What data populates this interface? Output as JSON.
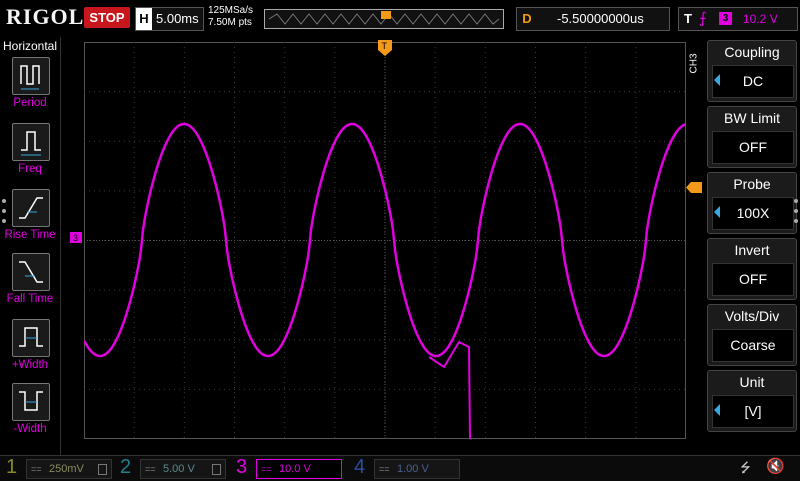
{
  "brand": "RIGOL",
  "status": "STOP",
  "horizontal": {
    "label": "H",
    "timebase": "5.00ms"
  },
  "sample_rate": "125MSa/s",
  "memory_depth": "7.50M pts",
  "delay": {
    "label": "D",
    "value": "-5.50000000us"
  },
  "trigger": {
    "label": "T",
    "source": "3",
    "level": "10.2 V"
  },
  "left_menu": {
    "title": "Horizontal",
    "items": [
      {
        "label": "Period"
      },
      {
        "label": "Freq"
      },
      {
        "label": "Rise Time"
      },
      {
        "label": "Fall Time"
      },
      {
        "label": "+Width"
      },
      {
        "label": "-Width"
      }
    ]
  },
  "right_menu": {
    "channel_tag": "CH3",
    "items": [
      {
        "title": "Coupling",
        "value": "DC",
        "arrow": true
      },
      {
        "title": "BW Limit",
        "value": "OFF",
        "arrow": false
      },
      {
        "title": "Probe",
        "value": "100X",
        "arrow": true
      },
      {
        "title": "Invert",
        "value": "OFF",
        "arrow": false
      },
      {
        "title": "Volts/Div",
        "value": "Coarse",
        "arrow": false
      },
      {
        "title": "Unit",
        "value": "[V]",
        "arrow": true
      }
    ]
  },
  "channels": [
    {
      "num": "1",
      "scale": "250mV",
      "color": "#e8d600",
      "active": false
    },
    {
      "num": "2",
      "scale": "5.00 V",
      "color": "#26c6e0",
      "active": false
    },
    {
      "num": "3",
      "scale": "10.0 V",
      "color": "#e000e0",
      "active": true
    },
    {
      "num": "4",
      "scale": "1.00 V",
      "color": "#2a6ef0",
      "active": false
    }
  ],
  "markers": {
    "ch_marker": "3",
    "trigger_marker": "T"
  },
  "colors": {
    "trace": "#e000e0",
    "trigger": "#f39a1a",
    "grid": "#3a3a3a",
    "accent": "#38a8e0"
  }
}
